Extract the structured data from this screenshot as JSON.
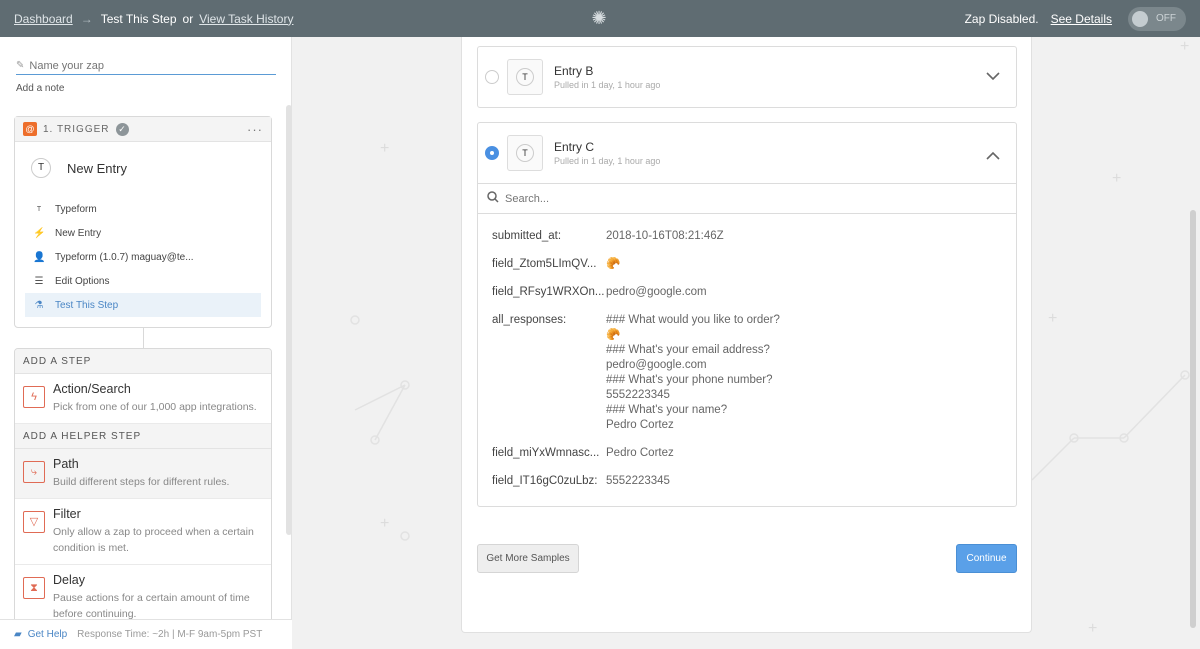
{
  "topbar": {
    "dashboard_link": "Dashboard",
    "arrow": "→",
    "current_step": "Test This Step",
    "or_text": "or",
    "history_link": "View Task History",
    "status_text": "Zap Disabled.",
    "see_details": "See Details",
    "toggle_label": "OFF"
  },
  "sidebar": {
    "name_placeholder": "Name your zap",
    "add_note": "Add a note",
    "trigger": {
      "label": "1. TRIGGER",
      "title": "New Entry",
      "items": [
        {
          "icon": "typeform-icon",
          "label": "Typeform"
        },
        {
          "icon": "lightning-icon",
          "label": "New Entry"
        },
        {
          "icon": "person-icon",
          "label": "Typeform (1.0.7) maguay@te..."
        },
        {
          "icon": "list-icon",
          "label": "Edit Options"
        },
        {
          "icon": "flask-icon",
          "label": "Test This Step"
        }
      ]
    },
    "add_step_label": "ADD A STEP",
    "action_title": "Action/Search",
    "action_desc": "Pick from one of our 1,000 app integrations.",
    "helper_label": "ADD A HELPER STEP",
    "path_title": "Path",
    "path_desc": "Build different steps for different rules.",
    "filter_title": "Filter",
    "filter_desc": "Only allow a zap to proceed when a certain condition is met.",
    "delay_title": "Delay",
    "delay_desc": "Pause actions for a certain amount of time before continuing.",
    "footer": {
      "get_help": "Get Help",
      "response_time": "Response Time: ~2h | M-F 9am-5pm PST"
    }
  },
  "main": {
    "entry_b": {
      "name": "Entry B",
      "sub": "Pulled in 1 day, 1 hour ago"
    },
    "entry_c": {
      "name": "Entry C",
      "sub": "Pulled in 1 day, 1 hour ago"
    },
    "app_letter": "T",
    "search_placeholder": "Search...",
    "fields": [
      {
        "key": "submitted_at:",
        "value": "2018-10-16T08:21:46Z"
      },
      {
        "key": "field_Ztom5LImQV...",
        "value": "🥐"
      },
      {
        "key": "field_RFsy1WRXOn...",
        "value": "pedro@google.com"
      },
      {
        "key": "all_responses:",
        "value": "### What would you like to order?\n🥐\n### What's your email address?\npedro@google.com\n### What's your phone number?\n5552223345\n### What's your name?\nPedro Cortez"
      },
      {
        "key": "field_miYxWmnasc...",
        "value": "Pedro Cortez"
      },
      {
        "key": "field_IT16gC0zuLbz:",
        "value": "5552223345"
      }
    ],
    "get_more_samples": "Get More Samples",
    "continue": "Continue"
  },
  "colors": {
    "topbar": "#5f6c72",
    "accent": "#4a90e2",
    "helper_red": "#e06b55",
    "trigger_orange": "#ed6e2b"
  }
}
